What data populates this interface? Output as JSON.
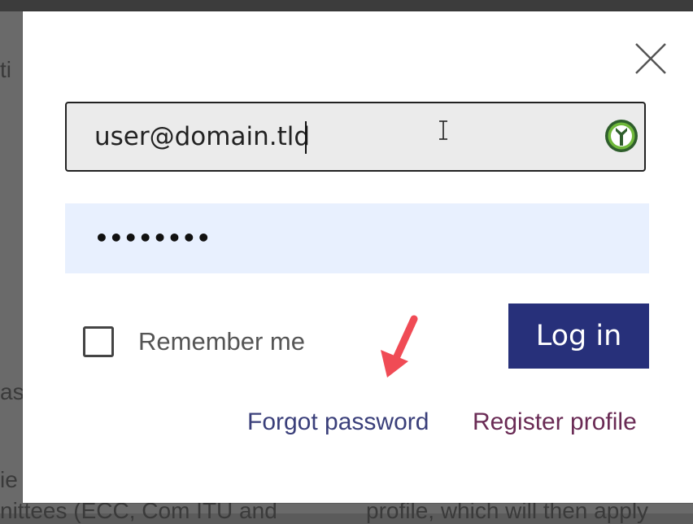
{
  "background": {
    "fragments": [
      "ti",
      "as",
      "ie",
      "nittees (ECC, Com ITU and",
      "profile, which will then apply"
    ]
  },
  "dialog": {
    "close_icon": "close-icon",
    "email": {
      "value": "user@domain.tld",
      "password_manager_icon": "key-icon"
    },
    "password": {
      "masked_value": "••••••••"
    },
    "remember_label": "Remember me",
    "login_label": "Log in",
    "forgot_label": "Forgot password",
    "register_label": "Register profile"
  },
  "colors": {
    "login_button": "#27307a",
    "password_fill": "#e8f0fe",
    "email_fill": "#ebebeb",
    "arrow": "#f04b55",
    "forgot_link": "#3a3f7a",
    "register_link": "#6a2b55"
  }
}
